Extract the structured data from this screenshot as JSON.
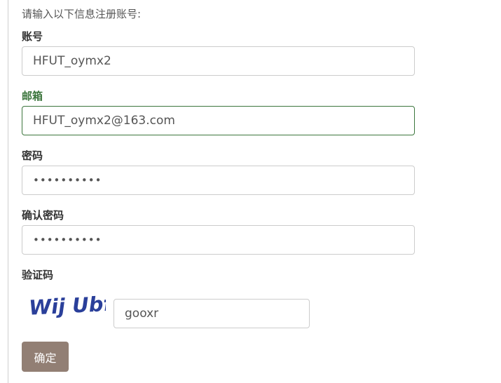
{
  "form": {
    "intro": "请输入以下信息注册账号:",
    "account": {
      "label": "账号",
      "value": "HFUT_oymx2"
    },
    "email": {
      "label": "邮箱",
      "value": "HFUT_oymx2@163.com"
    },
    "password": {
      "label": "密码",
      "value": "••••••••••"
    },
    "confirm_password": {
      "label": "确认密码",
      "value": "••••••••••"
    },
    "captcha": {
      "label": "验证码",
      "image_text": "Wij Ubf",
      "value": "gooxr"
    },
    "submit_label": "确定"
  },
  "colors": {
    "success": "#3c763d",
    "button": "#927f74",
    "captcha_text": "#2a3f9a"
  }
}
